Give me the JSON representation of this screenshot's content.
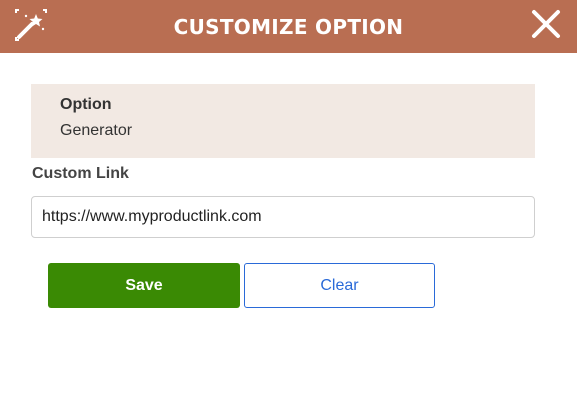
{
  "header": {
    "title": "CUSTOMIZE OPTION",
    "bg_color": "#b96e52",
    "left_icon": "magic-wand-icon",
    "right_icon": "close-icon"
  },
  "option": {
    "label": "Option",
    "value": "Generator",
    "bg_color": "#f2e9e3"
  },
  "custom_link": {
    "label": "Custom Link",
    "value": "https://www.myproductlink.com"
  },
  "buttons": {
    "save_label": "Save",
    "save_color": "#3a8a04",
    "clear_label": "Clear",
    "clear_color": "#2a6ad8"
  }
}
